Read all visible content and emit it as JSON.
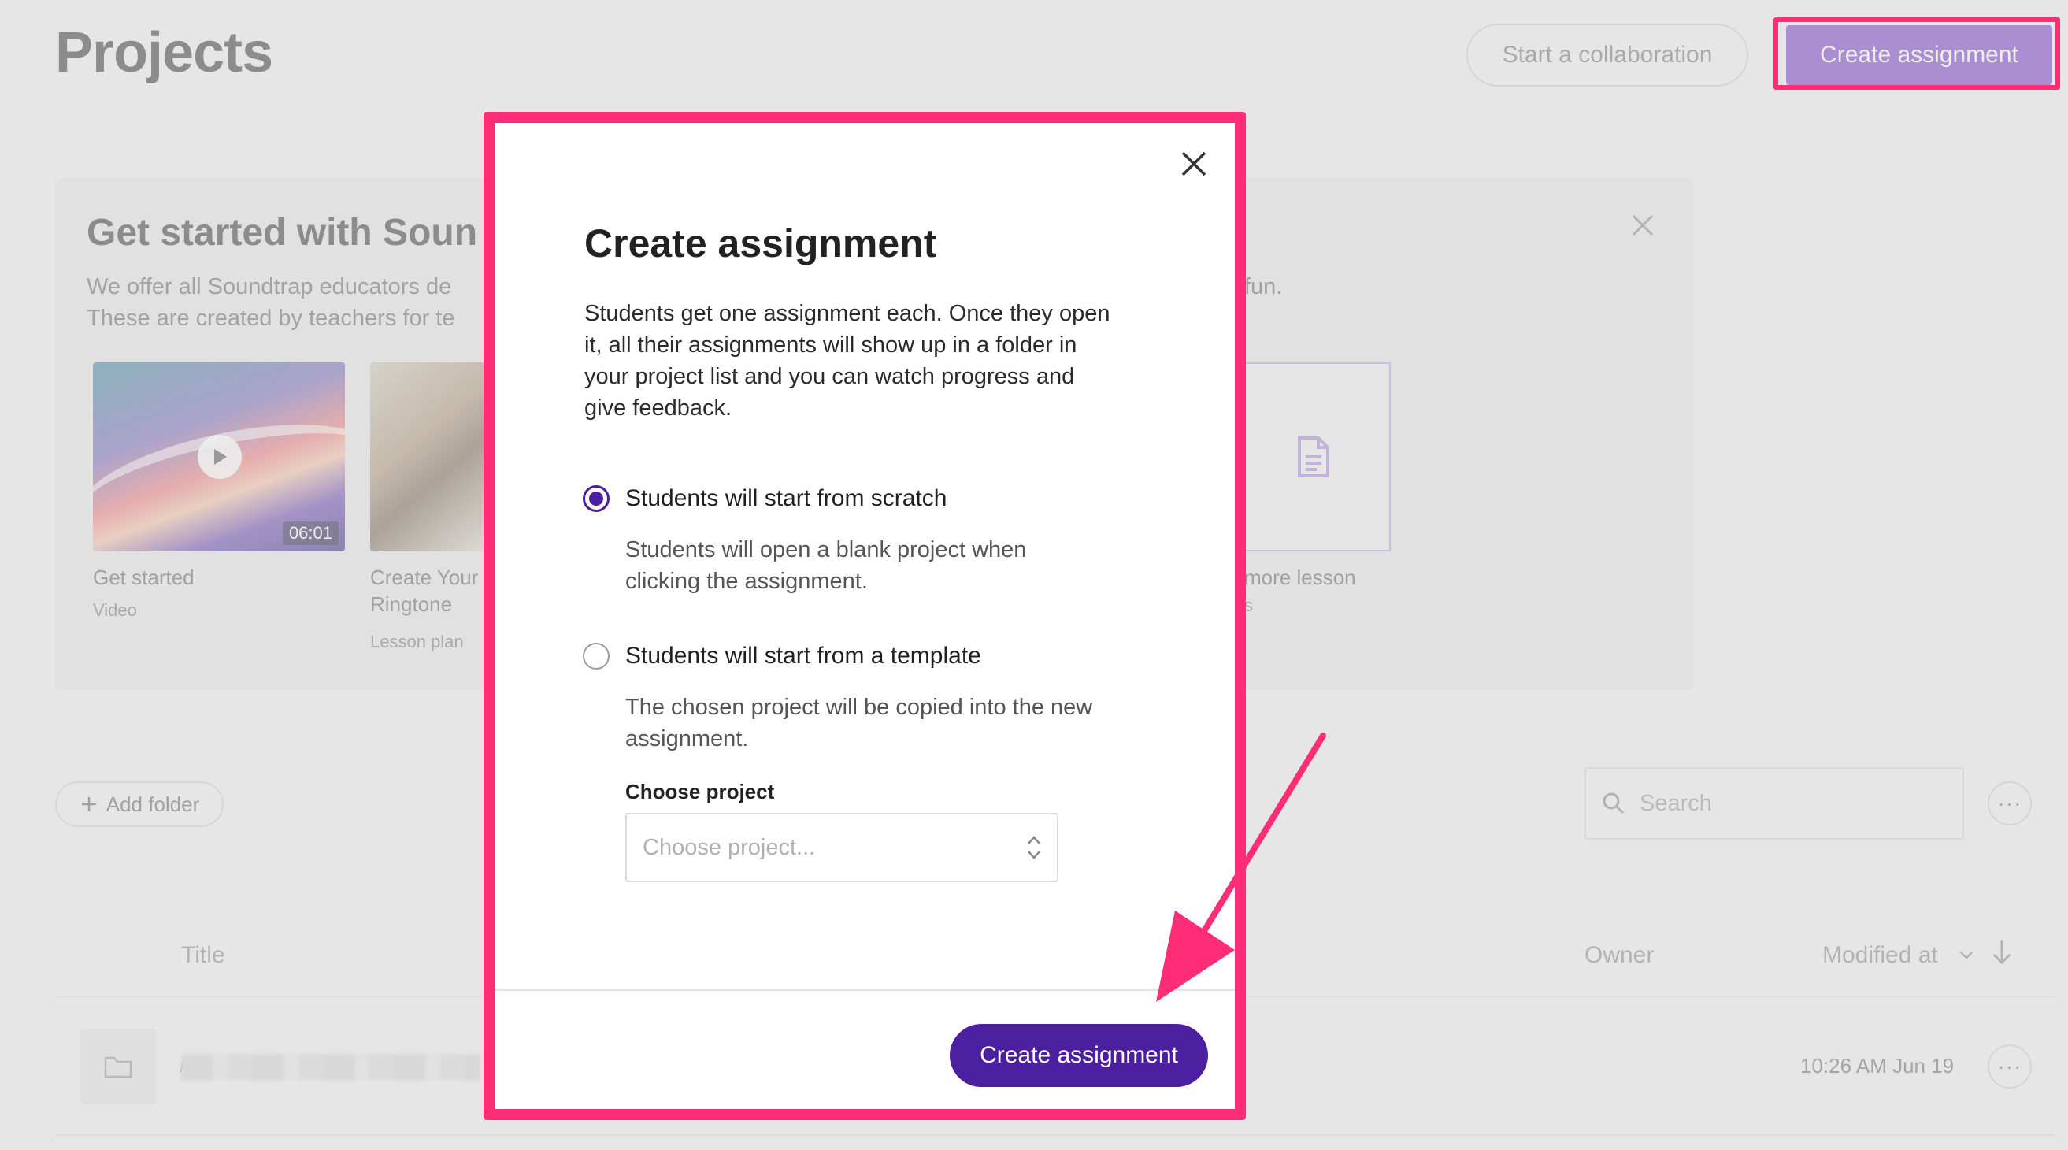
{
  "page": {
    "title": "Projects",
    "collab_button": "Start a collaboration",
    "create_button": "Create assignment"
  },
  "banner": {
    "title": "Get started with Soun",
    "desc_line1_left": "We offer all Soundtrap educators de",
    "desc_line1_right": "fun.",
    "desc_line2": "These are created by teachers for te",
    "cards": [
      {
        "label": "Get started",
        "sub": "Video",
        "duration": "06:01"
      },
      {
        "label_line1": "Create Your",
        "label_line2": "Ringtone",
        "sub": "Lesson plan"
      },
      {
        "label": "more lesson",
        "sub": "s"
      }
    ]
  },
  "list": {
    "add_folder": "Add folder",
    "search_placeholder": "Search",
    "columns": {
      "title": "Title",
      "owner": "Owner",
      "modified": "Modified at"
    },
    "rows": [
      {
        "name_prefix": "/",
        "modified": "10:26 AM Jun 19"
      }
    ],
    "more": "···"
  },
  "modal": {
    "title": "Create assignment",
    "description": "Students get one assignment each. Once they open it, all their assignments will show up in a folder in your project list and you can watch progress and give feedback.",
    "options": [
      {
        "label": "Students will start from scratch",
        "help": "Students will open a blank project when clicking the assignment.",
        "checked": true
      },
      {
        "label": "Students will start from a template",
        "help": "The chosen project will be copied into the new assignment.",
        "checked": false
      }
    ],
    "choose_label": "Choose project",
    "choose_placeholder": "Choose project...",
    "submit": "Create assignment"
  },
  "colors": {
    "accent": "#4c1ea0",
    "top_button": "#7a3fc6",
    "highlight": "#ff2d75"
  }
}
